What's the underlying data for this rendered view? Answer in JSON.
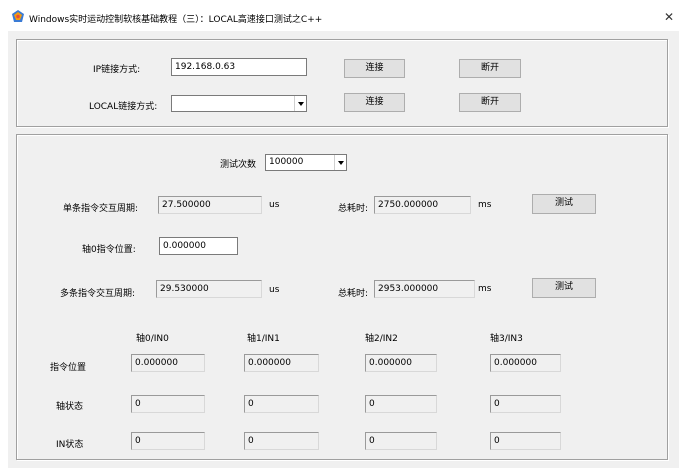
{
  "window": {
    "title": "Windows实时运动控制软核基础教程（三）：LOCAL高速接口测试之C++",
    "close_glyph": "✕"
  },
  "connection": {
    "ip_label": "IP链接方式:",
    "ip_value": "192.168.0.63",
    "ip_connect_label": "连接",
    "ip_disconnect_label": "断开",
    "local_label": "LOCAL链接方式:",
    "local_value": "",
    "local_connect_label": "连接",
    "local_disconnect_label": "断开"
  },
  "test": {
    "count_label": "测试次数",
    "count_value": "100000",
    "single_period_label": "单条指令交互周期:",
    "single_period_value": "27.500000",
    "single_period_unit": "us",
    "total_time_label_1": "总耗时:",
    "total_time_value_1": "2750.000000",
    "total_time_unit_1": "ms",
    "test_button_1": "测试",
    "axis0_pos_label": "轴0指令位置:",
    "axis0_pos_value": "0.000000",
    "multi_period_label": "多条指令交互周期:",
    "multi_period_value": "29.530000",
    "multi_period_unit": "us",
    "total_time_label_2": "总耗时:",
    "total_time_value_2": "2953.000000",
    "total_time_unit_2": "ms",
    "test_button_2": "测试"
  },
  "axes_table": {
    "columns": [
      "轴0/IN0",
      "轴1/IN1",
      "轴2/IN2",
      "轴3/IN3"
    ],
    "rows": [
      {
        "label": "指令位置",
        "values": [
          "0.000000",
          "0.000000",
          "0.000000",
          "0.000000"
        ]
      },
      {
        "label": "轴状态",
        "values": [
          "0",
          "0",
          "0",
          "0"
        ]
      },
      {
        "label": "IN状态",
        "values": [
          "0",
          "0",
          "0",
          "0"
        ]
      }
    ]
  }
}
